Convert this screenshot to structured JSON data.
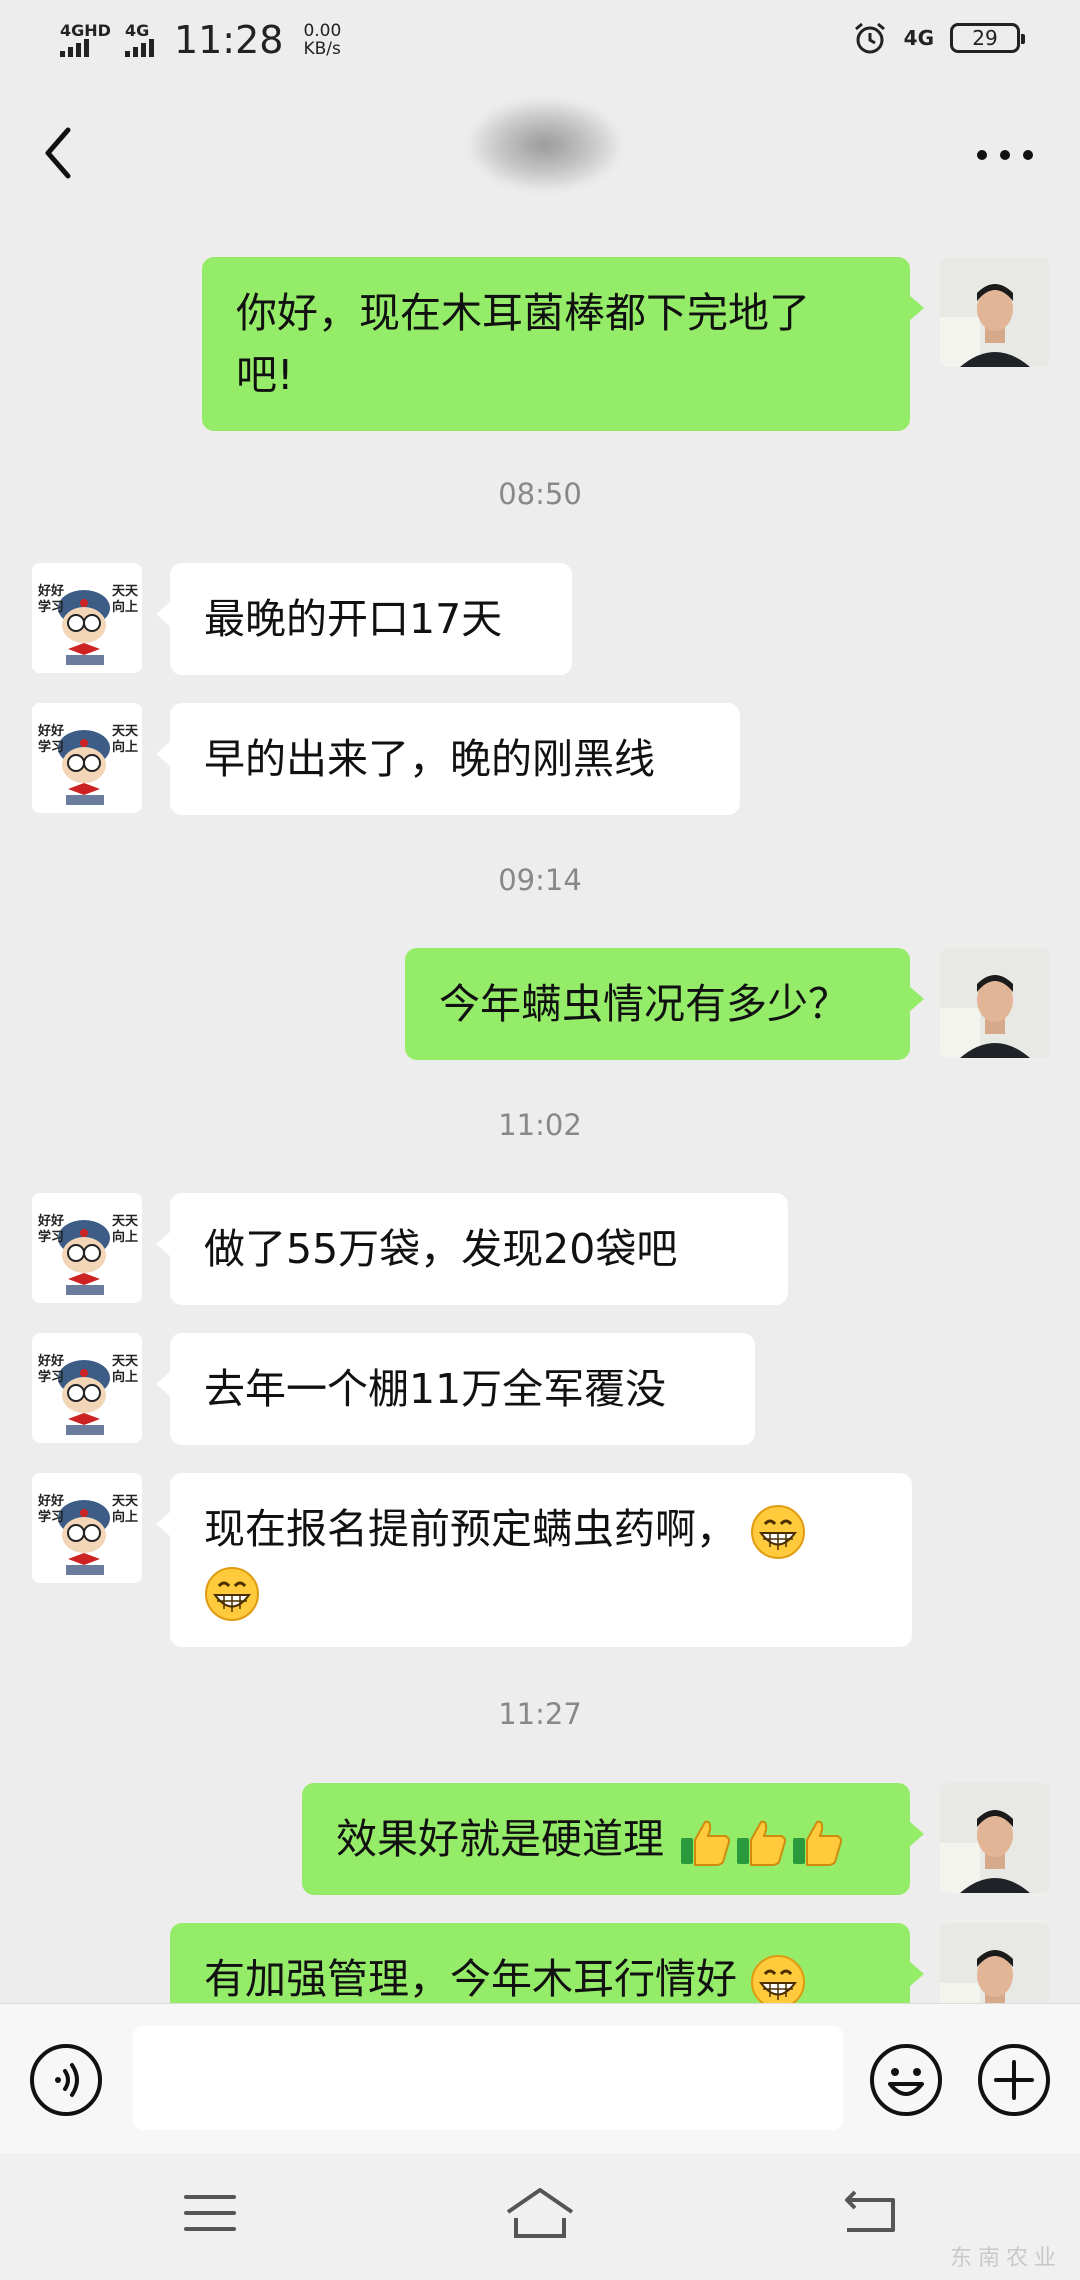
{
  "status_bar": {
    "sim1_label": "4GHD",
    "sim2_label": "4G",
    "time": "11:28",
    "speed_value": "0.00",
    "speed_unit": "KB/s",
    "network_right": "4G",
    "battery_level": "29",
    "icons": [
      "signal-icon",
      "signal-icon",
      "alarm-icon",
      "battery-icon"
    ]
  },
  "header": {
    "contact_name_blurred": true,
    "icons": [
      "back-arrow-icon",
      "more-options-icon"
    ]
  },
  "messages": [
    {
      "sender": "me",
      "text": "你好，现在木耳菌棒都下完地了吧!",
      "lines": [
        "你好，现在木耳菌棒都下完地了",
        "吧!"
      ]
    },
    {
      "type": "timestamp",
      "text": "08:50"
    },
    {
      "sender": "them",
      "text": "最晚的开口17天"
    },
    {
      "sender": "them",
      "text": "早的出来了，晚的刚黑线"
    },
    {
      "type": "timestamp",
      "text": "09:14"
    },
    {
      "sender": "me",
      "text": "今年螨虫情况有多少？"
    },
    {
      "type": "timestamp",
      "text": "11:02"
    },
    {
      "sender": "them",
      "text": "做了55万袋，发现20袋吧"
    },
    {
      "sender": "them",
      "text": "去年一个棚11万全军覆没"
    },
    {
      "sender": "them",
      "text": "现在报名提前预定螨虫药啊，",
      "emoji": [
        "grin-emoji",
        "grin-emoji"
      ]
    },
    {
      "type": "timestamp",
      "text": "11:27"
    },
    {
      "sender": "me",
      "text": "效果好就是硬道理",
      "emoji": [
        "thumbs-up-emoji",
        "thumbs-up-emoji",
        "thumbs-up-emoji"
      ]
    },
    {
      "sender": "me",
      "text": "有加强管理，今年木耳行情好",
      "emoji": [
        "grin-emoji"
      ]
    }
  ],
  "avatars": {
    "them": "cartoon-student-avatar",
    "them_caption_left": "好好学习",
    "them_caption_right": "天天向上",
    "me": "photo-avatar"
  },
  "input_bar": {
    "placeholder": "",
    "icons": [
      "voice-icon",
      "emoji-icon",
      "plus-icon"
    ]
  },
  "nav_bar": {
    "icons": [
      "menu-icon",
      "home-icon",
      "back-icon"
    ]
  },
  "watermark": "东南农业",
  "colors": {
    "background": "#ededed",
    "my_bubble": "#95ec69",
    "their_bubble": "#ffffff",
    "timestamp_text": "#888888"
  }
}
